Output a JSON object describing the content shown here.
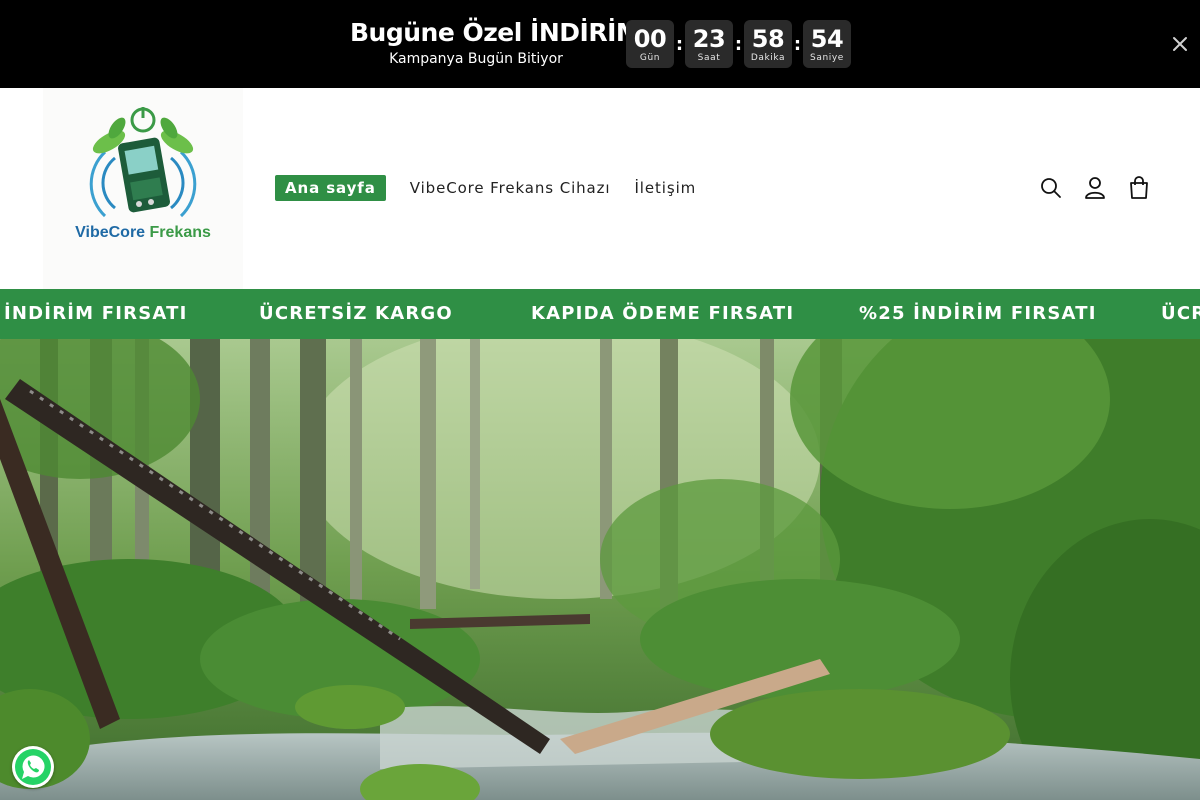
{
  "announcement": {
    "title": "Bugüne Özel İNDİRİM",
    "subtitle": "Kampanya Bugün Bitiyor",
    "countdown": [
      {
        "value": "00",
        "label": "Gün"
      },
      {
        "value": "23",
        "label": "Saat"
      },
      {
        "value": "58",
        "label": "Dakika"
      },
      {
        "value": "54",
        "label": "Saniye"
      }
    ],
    "separator": ":",
    "close_icon": "close-icon"
  },
  "header": {
    "logo": {
      "word1": "VibeCore",
      "word2": "Frekans"
    },
    "nav": [
      {
        "label": "Ana sayfa",
        "active": true
      },
      {
        "label": "VibeCore Frekans Cihazı",
        "active": false
      },
      {
        "label": "İletişim",
        "active": false
      }
    ],
    "icons": [
      "search-icon",
      "account-icon",
      "cart-icon"
    ]
  },
  "marquee": {
    "items": [
      "İNDİRİM FIRSATI",
      "ÜCRETSİZ KARGO",
      "KAPIDA ÖDEME FIRSATI",
      "%25 İNDİRİM FIRSATI",
      "ÜCR"
    ]
  },
  "hero": {
    "image": "forest-stream-image"
  },
  "whatsapp": {
    "icon": "whatsapp-icon"
  },
  "colors": {
    "brand_green": "#2f8f45",
    "announce_bg": "#000000",
    "countdown_box": "#2a2a2a"
  }
}
